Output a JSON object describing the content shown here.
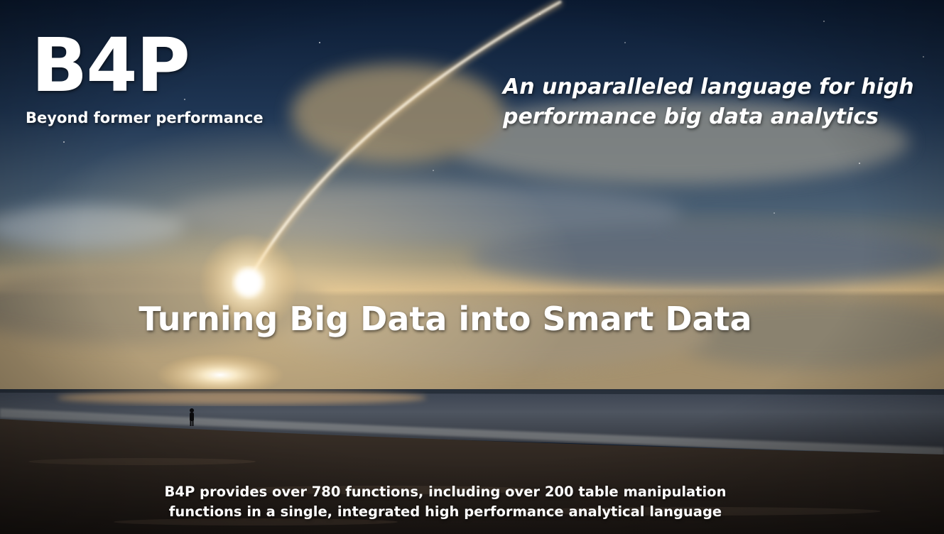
{
  "logo": {
    "text": "B4P",
    "subtitle": "Beyond former performance"
  },
  "tagline": {
    "line1": "An unparalleled language for high",
    "line2": "performance big data analytics"
  },
  "headline": "Turning Big Data into Smart Data",
  "footer": {
    "line1": "B4P provides over 780 functions, including over 200 table manipulation",
    "line2": "functions in a single, integrated high performance analytical language"
  },
  "colors": {
    "sky_top": "#0c1e38",
    "sky_mid": "#3c5470",
    "horizon_glow": "#e6c588",
    "sea": "#2a3440",
    "sand": "#2b241f",
    "text": "#ffffff"
  }
}
